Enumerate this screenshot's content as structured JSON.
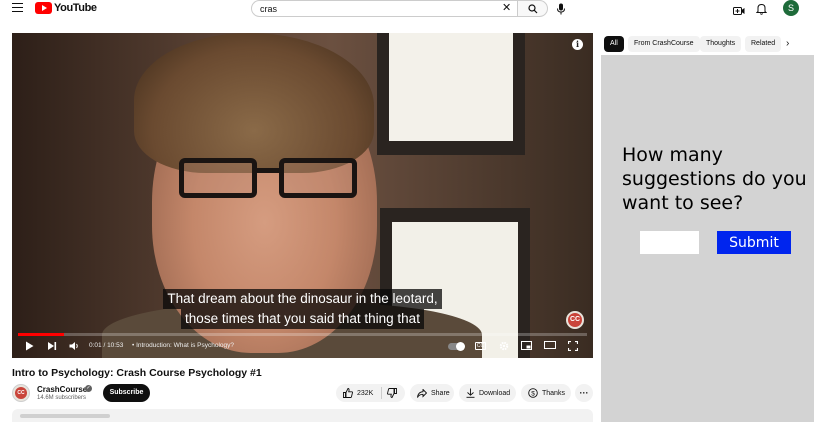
{
  "header": {
    "logo_text": "YouTube",
    "search_value": "cras",
    "avatar_letter": "S"
  },
  "player": {
    "caption_line1": "That dream about the dinosaur in the leotard,",
    "caption_line2": "those times that you said that thing that",
    "time": "0:01 / 10:53",
    "chapter": "• Introduction: What is Psychology?",
    "progress_fraction": 0.08,
    "cc_label": "CC",
    "watermark": "CC"
  },
  "video": {
    "title": "Intro to Psychology: Crash Course Psychology #1",
    "channel_name": "CrashCourse",
    "subscribers": "14.6M subscribers",
    "subscribe_label": "Subscribe",
    "likes": "232K",
    "share_label": "Share",
    "download_label": "Download",
    "thanks_label": "Thanks",
    "more_label": "···"
  },
  "chips": [
    {
      "label": "All",
      "active": true
    },
    {
      "label": "From CrashCourse",
      "active": false
    },
    {
      "label": "Thoughts",
      "active": false
    },
    {
      "label": "Related",
      "active": false
    }
  ],
  "overlay": {
    "question": "How many suggestions do you want to see?",
    "input_value": "",
    "submit_label": "Submit"
  },
  "colors": {
    "brand_red": "#ff0000",
    "submit_blue": "#0025ee",
    "overlay_gray": "#d3d3d3"
  }
}
